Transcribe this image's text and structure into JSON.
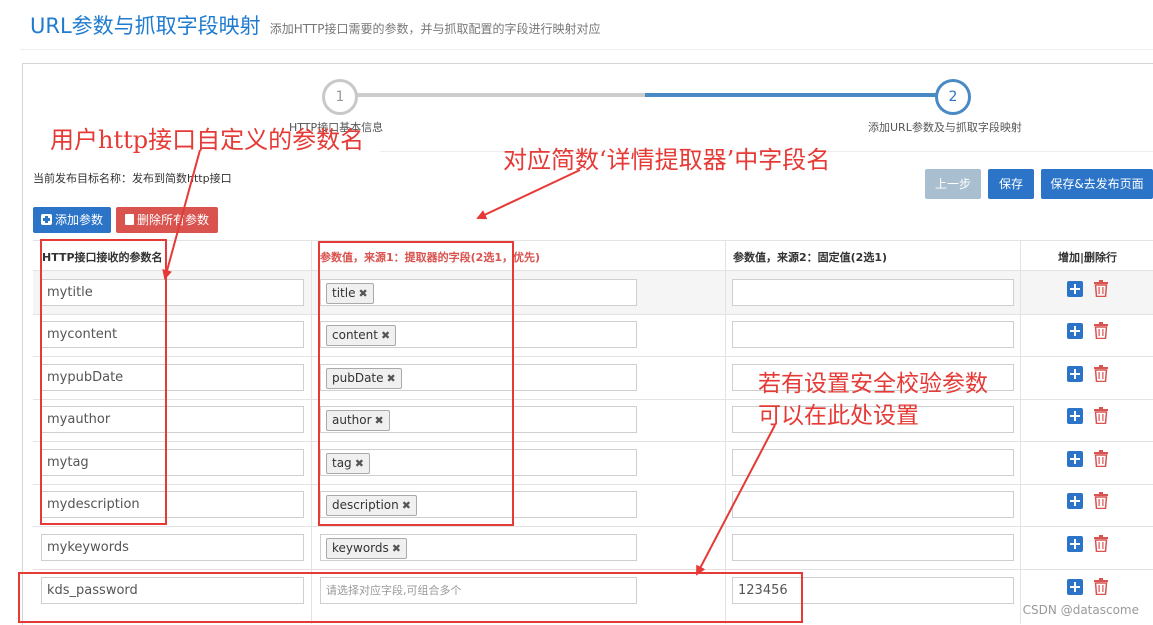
{
  "header": {
    "title": "URL参数与抓取字段映射",
    "subtitle": "添加HTTP接口需要的参数，并与抓取配置的字段进行映射对应"
  },
  "wizard": {
    "steps": [
      {
        "number": "1",
        "label": "HTTP接口基本信息"
      },
      {
        "number": "2",
        "label": "添加URL参数及与抓取字段映射"
      }
    ],
    "active_step": 2
  },
  "target_label": "当前发布目标名称：发布到简数http接口",
  "toolbar": {
    "prev_label": "上一步",
    "save_label": "保存",
    "save_publish_label": "保存&去发布页面",
    "add_param_label": "添加参数",
    "delete_all_label": "删除所有参数"
  },
  "table": {
    "headers": [
      "HTTP接口接收的参数名",
      "参数值，来源1：提取器的字段(2选1，优先)",
      "参数值，来源2：固定值(2选1)",
      "增加|删除行"
    ],
    "placeholder": "请选择对应字段,可组合多个",
    "rows": [
      {
        "name": "mytitle",
        "field": "title",
        "fixed": ""
      },
      {
        "name": "mycontent",
        "field": "content",
        "fixed": ""
      },
      {
        "name": "mypubDate",
        "field": "pubDate",
        "fixed": ""
      },
      {
        "name": "myauthor",
        "field": "author",
        "fixed": ""
      },
      {
        "name": "mytag",
        "field": "tag",
        "fixed": ""
      },
      {
        "name": "mydescription",
        "field": "description",
        "fixed": ""
      },
      {
        "name": "mykeywords",
        "field": "keywords",
        "fixed": ""
      },
      {
        "name": "kds_password",
        "field": "",
        "fixed": "123456"
      }
    ]
  },
  "annotations": {
    "a1": "用户http接口自定义的参数名",
    "a2": "对应简数‘详情提取器’中字段名",
    "a3_line1": "若有设置安全校验参数",
    "a3_line2": "可以在此处设置"
  },
  "colors": {
    "accent": "#2b74c7",
    "danger": "#d9534f",
    "annotation": "#e53a36"
  },
  "watermark": "CSDN @datascome"
}
